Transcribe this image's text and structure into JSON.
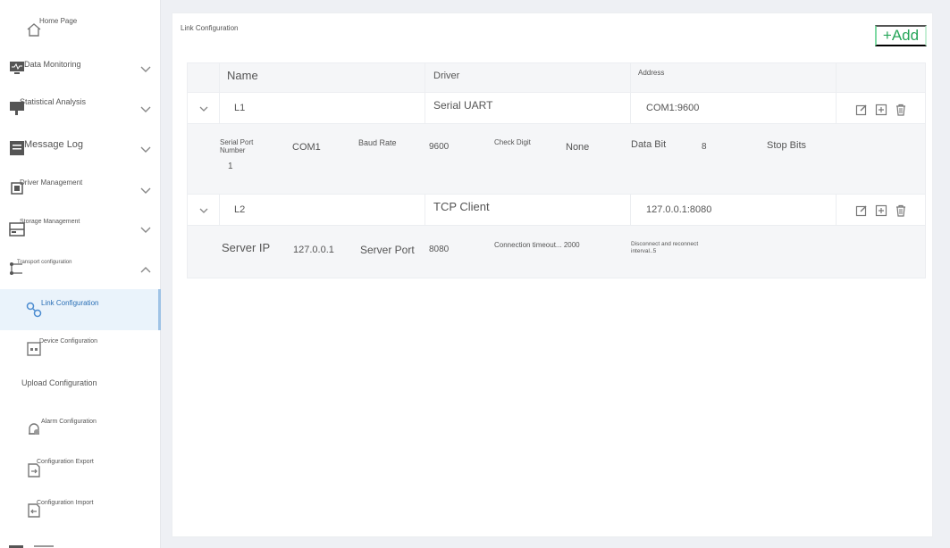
{
  "sidebar": {
    "items": [
      {
        "label": "Home Page",
        "icon": "home-icon"
      },
      {
        "label": "Data Monitoring",
        "icon": "monitor-icon"
      },
      {
        "label": "Statistical Analysis",
        "icon": "analysis-icon"
      },
      {
        "label": "Message Log",
        "icon": "log-icon"
      },
      {
        "label": "Driver Management",
        "icon": "chip-icon"
      },
      {
        "label": "Storage Management",
        "icon": "storage-icon"
      },
      {
        "label": "Transport configuration",
        "icon": "transport-icon"
      },
      {
        "label": "Link Configuration",
        "icon": "link-icon",
        "active": true
      },
      {
        "label": "Device Configuration",
        "icon": "device-icon"
      },
      {
        "label": "Upload Configuration"
      },
      {
        "label": "Alarm Configuration",
        "icon": "alarm-icon"
      },
      {
        "label": "Configuration Export",
        "icon": "export-icon"
      },
      {
        "label": "Configuration Import",
        "icon": "import-icon"
      }
    ]
  },
  "main": {
    "title": "Link Configuration",
    "add_label": "+Add",
    "columns": [
      "Name",
      "Driver",
      "Address"
    ],
    "rows": [
      {
        "name": "L1",
        "driver": "Serial UART",
        "address": "COM1:9600",
        "details": {
          "serial_port_label": "Serial Port Number",
          "serial_port_value": "COM1",
          "baud_label": "Baud Rate",
          "baud_value": "9600",
          "check_label": "Check Digit",
          "check_value": "None",
          "data_bit_label": "Data Bit",
          "data_bit_value": "8",
          "stop_label": "Stop Bits",
          "stop_value": "1"
        }
      },
      {
        "name": "L2",
        "driver": "TCP Client",
        "address": "127.0.0.1:8080",
        "details": {
          "server_ip_label": "Server IP",
          "server_ip_value": "127.0.0.1",
          "server_port_label": "Server Port",
          "server_port_value": "8080",
          "timeout_text": "Connection timeout... 2000",
          "reconnect_text": "Disconnect and reconnect interval..5"
        }
      }
    ]
  },
  "colors": {
    "accent_green": "#27a65a",
    "active_blue": "#2a6fb5",
    "active_bg": "#eaf3fb"
  }
}
